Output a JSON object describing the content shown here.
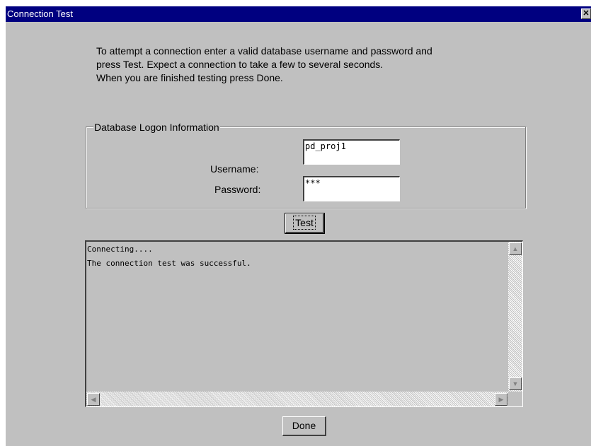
{
  "window": {
    "title": "Connection Test",
    "close_glyph": "✕"
  },
  "instructions": [
    "To attempt a connection enter a valid database username and password and",
    "press Test.  Expect a connection to take a few to several seconds.",
    "When you are finished testing press Done."
  ],
  "logon": {
    "group_label": "Database Logon Information",
    "username_label": "Username:",
    "username_value": "pd_proj1",
    "password_label": "Password:",
    "password_value": "***"
  },
  "buttons": {
    "test_label": "Test",
    "done_label": "Done"
  },
  "output": {
    "lines": [
      "Connecting....",
      "The connection test was successful."
    ]
  },
  "scrollbar_glyphs": {
    "up": "▲",
    "down": "▼",
    "left": "◀",
    "right": "▶"
  },
  "colors": {
    "titlebar": "#000080",
    "face": "#c0c0c0"
  }
}
